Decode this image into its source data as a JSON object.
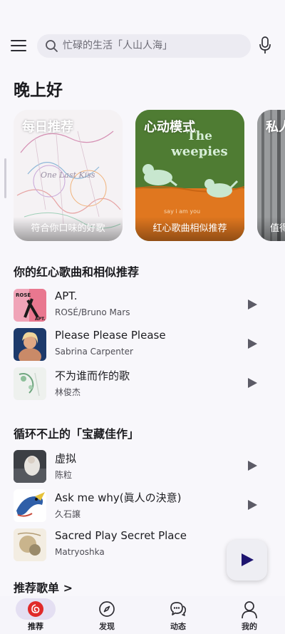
{
  "search": {
    "placeholder": "忙碌的生活「人山人海」"
  },
  "greeting": "晚上好",
  "cards": [
    {
      "title": "每日推荐",
      "subtitle": "符合你口味的好歌"
    },
    {
      "title": "心动模式",
      "subtitle": "红心歌曲相似推荐",
      "art_text_1": "The",
      "art_text_2": "weepies",
      "art_text_3": "say i am you"
    },
    {
      "title": "私人",
      "subtitle": "值得"
    }
  ],
  "section1": {
    "title": "你的红心歌曲和相似推荐",
    "songs": [
      {
        "title": "APT.",
        "artist": "ROSÉ/Bruno Mars",
        "cover_text": "ROSÉ"
      },
      {
        "title": "Please Please Please",
        "artist": "Sabrina Carpenter"
      },
      {
        "title": "不为谁而作的歌",
        "artist": "林俊杰"
      }
    ]
  },
  "section2": {
    "title": "循环不止的「宝藏佳作」",
    "songs": [
      {
        "title": "虚拟",
        "artist": "陈粒"
      },
      {
        "title": "Ask me why(眞人の決意)",
        "artist": "久石譲"
      },
      {
        "title": "Sacred Play Secret Place",
        "artist": "Matryoshka"
      }
    ]
  },
  "more_playlists": "推荐歌单 >",
  "nav": [
    {
      "label": "推荐",
      "icon": "netease-logo-icon",
      "active": true
    },
    {
      "label": "发现",
      "icon": "compass-icon"
    },
    {
      "label": "动态",
      "icon": "chat-bubbles-icon"
    },
    {
      "label": "我的",
      "icon": "person-icon"
    }
  ],
  "colors": {
    "accent": "#e02a2a",
    "active_pill": "#e4dff2",
    "play_icon": "#5c5b66",
    "fab_play": "#1e1570"
  }
}
